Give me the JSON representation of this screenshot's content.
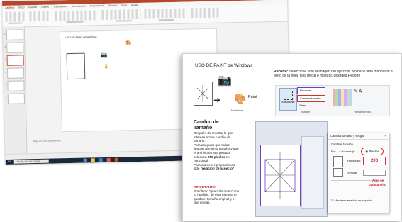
{
  "background_window": {
    "title_bar": "",
    "ribbon_tabs": [
      "Archivo",
      "Inicio",
      "Insertar",
      "Diseño",
      "Transiciones",
      "Animaciones",
      "Presentación",
      "Revisar",
      "Vista",
      "Ayuda"
    ],
    "slide_heading": "USO DE PAINT de Windows",
    "notes_placeholder": "Haga clic para agregar notas",
    "status_text": "",
    "taskbar_search": "Escribe aquí para buscar",
    "thumb_numbers": [
      "1",
      "2",
      "3",
      "4",
      "5",
      "6"
    ]
  },
  "slide": {
    "title": "USO DE PAINT de Windows",
    "recorte_label": "Recorte:",
    "recorte_text": "Seleccione sólo la imagen del ejercicio. No hace falta mandar ni el texto de la hoja, ni la mesa o mostrar, después Recorte",
    "paint_label": "Paint",
    "minimizar_label": "Minimizar",
    "ribbon": {
      "select_label": "Seleccionar",
      "items": [
        "Recortar",
        "Cambiar tamaño",
        "Girar"
      ],
      "image_group_label": "Imagen",
      "tools_label": "Herramientas",
      "tools_glyphs": "✎A"
    },
    "cambio": {
      "heading": "Cambio de Tamaño:",
      "text1": "Después de recortar lo que interesa active cambio de tamaño.",
      "text2": "Para asegurar que todos lleguen al mismo tamaño y que el archivo no sea pesado coloquen",
      "highlight": "200 pixeles",
      "text3": "en horizontal.",
      "text4": "Para mantener proporciones tilde",
      "italic": "“relación de aspecto”"
    },
    "importante": {
      "heading": "IMPORTANTE:",
      "text": "Por último “guardalo como” con tu Apellido, de esta manera te queda el tamaño original y el que envías."
    },
    "dialog": {
      "title": "Cambiar tamaño y sesgar",
      "section": "Cambiar tamaño",
      "por_label": "Por:",
      "porcentaje": "Porcentaje",
      "pixeles": "Píxeles",
      "horizontal_label": "Horizontal:",
      "horizontal_value": "200",
      "vertical_label": "Vertical:",
      "mantener": "Mantener relación de aspecto",
      "close": "×"
    },
    "aqui_note": "Aquí se ajusta sólo",
    "accent_colors": {
      "purple": "#6f3dc4",
      "red": "#d33030"
    }
  }
}
